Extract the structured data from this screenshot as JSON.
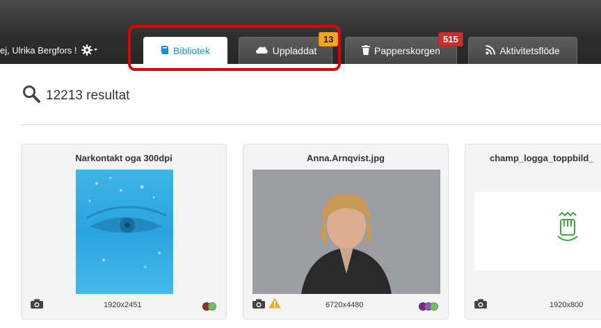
{
  "header": {
    "greeting": "ej, Ulrika Bergfors !",
    "gear_icon": "gear-icon"
  },
  "tabs": [
    {
      "label": "Bibliotek",
      "icon": "book-icon",
      "active": true
    },
    {
      "label": "Uppladdat",
      "icon": "cloud-icon",
      "badge": "13"
    },
    {
      "label": "Papperskorgen",
      "icon": "trash-icon",
      "badge": "515"
    },
    {
      "label": "Aktivitetsflöde",
      "icon": "rss-icon"
    }
  ],
  "search": {
    "results_label": "12213 resultat"
  },
  "cards": [
    {
      "title": "Narkontakt oga 300dpi",
      "dimensions": "1920x2451"
    },
    {
      "title": "Anna.Arnqvist.jpg",
      "dimensions": "6720x4480"
    },
    {
      "title": "champ_logga_toppbild_",
      "dimensions": "1920x800"
    }
  ],
  "colors": {
    "accent": "#1a8fd0",
    "highlight": "#e00000",
    "badge_orange": "#f5a623",
    "badge_red": "#c9302c"
  }
}
